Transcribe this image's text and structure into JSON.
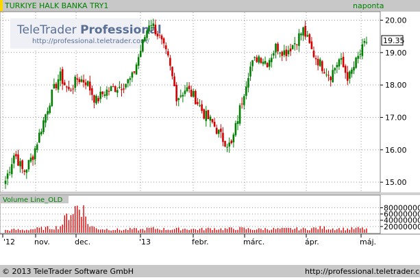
{
  "header": {
    "instrument": "TURKIYE HALK BANKA TRY1",
    "interval": "naponta"
  },
  "watermark": {
    "brand_plain": "TeleTrader",
    "brand_bold": "Professional",
    "url": "http://professional.teletrader.com/"
  },
  "volume_panel": {
    "label": "Volume Line_OLD"
  },
  "footer": {
    "copyright": "© 2013 TeleTrader Software GmbH",
    "url": "http://professional.teletrader.com/"
  },
  "colors": {
    "up": "#008000",
    "down": "#d40000",
    "header_bg": "#c8c8c8",
    "volume_bar": "#e00000",
    "watermark": "#5a6f96"
  },
  "chart_data": {
    "type": "candlestick",
    "title": "TURKIYE HALK BANKA TRY1",
    "last_price": "19.35",
    "ylim": [
      14.75,
      20.2
    ],
    "yticks": [
      "20.00",
      "19.00",
      "18.00",
      "17.00",
      "16.00",
      "15.00"
    ],
    "volume_yticks": [
      "80000000",
      "60000000",
      "40000000",
      "20000000"
    ],
    "volume_ylim": [
      0,
      92000000
    ],
    "xticks": [
      "'12",
      "nov.",
      "dec.",
      "'13",
      "febr.",
      "márc.",
      "ápr.",
      "máj."
    ],
    "grid": true,
    "price_path": [
      15.05,
      15.9,
      15.3,
      15.8,
      16.7,
      17.6,
      18.3,
      17.8,
      18.2,
      18.1,
      17.5,
      17.8,
      17.9,
      18.0,
      18.2,
      19.1,
      20.0,
      19.5,
      18.8,
      17.6,
      17.9,
      17.6,
      17.1,
      16.8,
      16.35,
      16.1,
      17.3,
      18.5,
      18.9,
      18.7,
      19.2,
      19.0,
      19.3,
      19.7,
      19.0,
      18.6,
      18.3,
      18.8,
      18.2,
      18.8,
      19.35
    ],
    "volume_path": [
      8,
      10,
      9,
      12,
      14,
      16,
      18,
      60,
      85,
      30,
      14,
      12,
      11,
      9,
      12,
      10,
      14,
      13,
      11,
      12,
      13,
      11,
      12,
      14,
      12,
      13,
      14,
      12,
      11,
      13,
      12,
      12,
      13,
      12,
      14,
      16,
      14,
      13,
      12,
      14,
      13
    ]
  }
}
